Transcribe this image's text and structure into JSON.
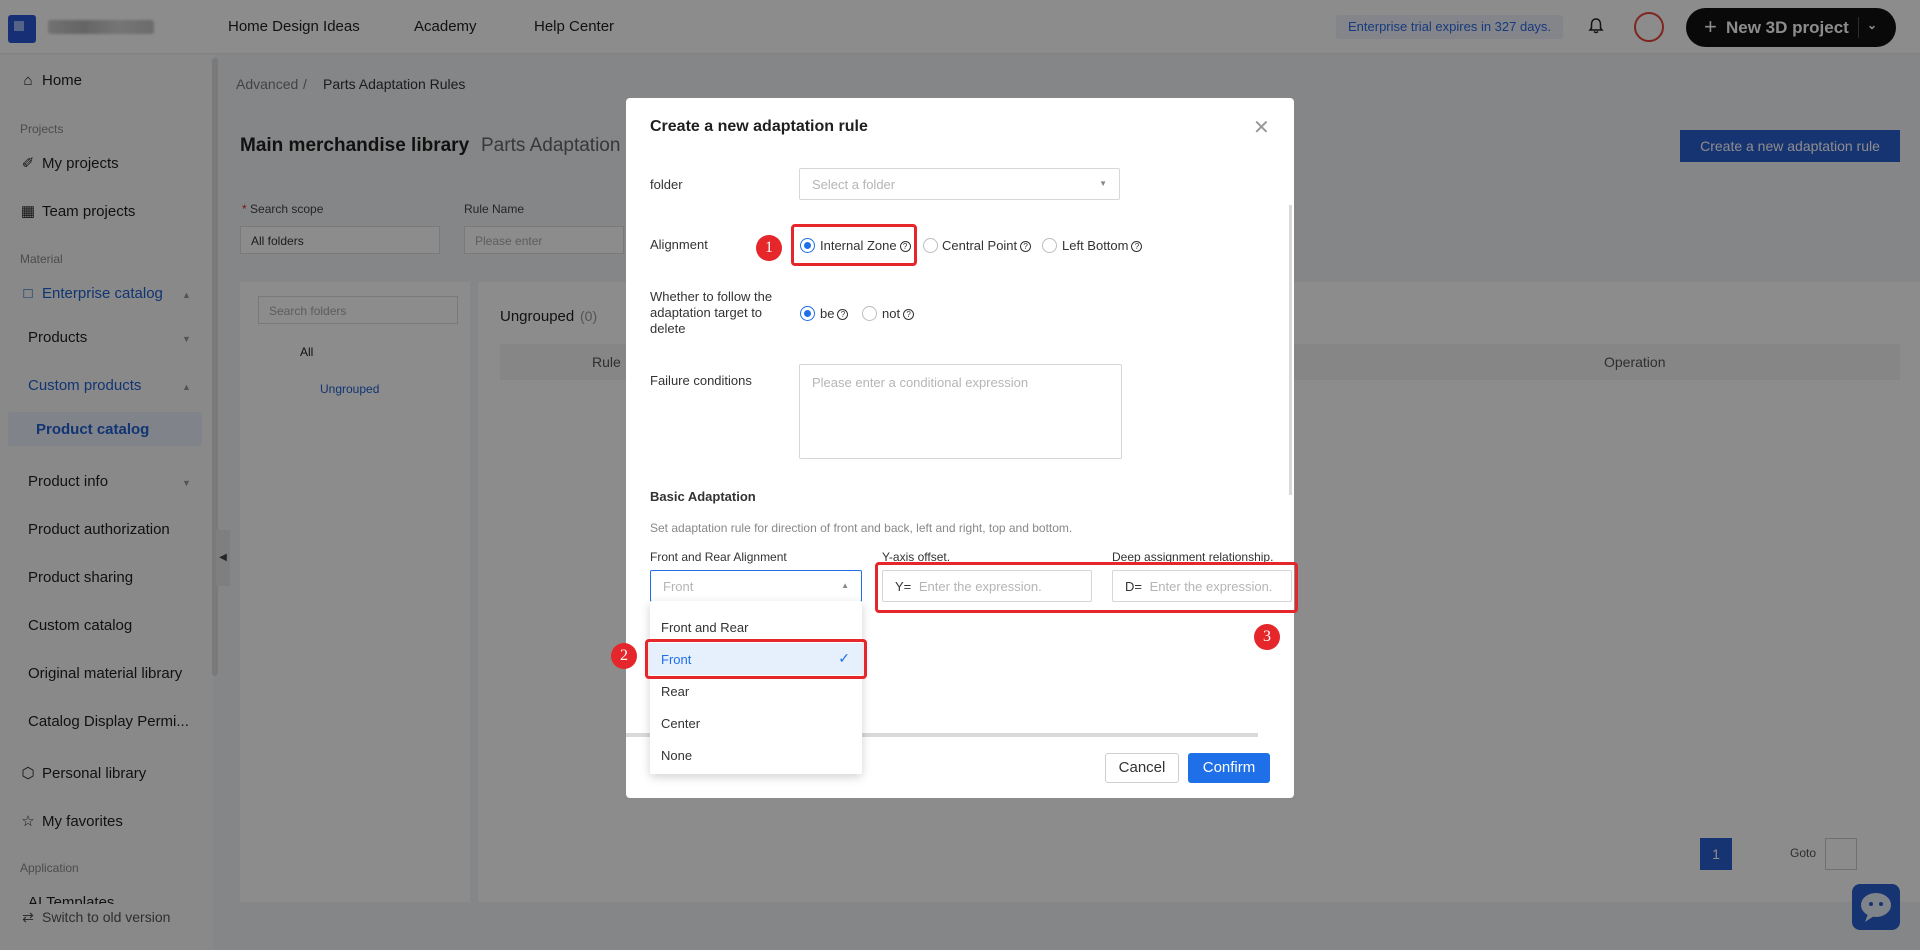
{
  "header": {
    "nav": [
      "Home Design Ideas",
      "Academy",
      "Help Center"
    ],
    "trial": "Enterprise trial expires in 327 days.",
    "new_project": "New 3D project"
  },
  "sidebar": {
    "home": "Home",
    "sec_projects": "Projects",
    "my_projects": "My projects",
    "team_projects": "Team projects",
    "sec_material": "Material",
    "enterprise_catalog": "Enterprise catalog",
    "products": "Products",
    "custom_products": "Custom products",
    "product_catalog": "Product catalog",
    "product_info": "Product info",
    "product_authorization": "Product authorization",
    "product_sharing": "Product sharing",
    "custom_catalog": "Custom catalog",
    "original_material": "Original material library",
    "catalog_display": "Catalog Display Permi...",
    "personal_library": "Personal library",
    "my_favorites": "My favorites",
    "sec_application": "Application",
    "ai_templates": "AI Templates",
    "switch_old": "Switch to old version"
  },
  "page": {
    "breadcrumb": [
      "Advanced",
      "Parts Adaptation Rules"
    ],
    "tab_main": "Main merchandise library",
    "tab_parts": "Parts Adaptation",
    "create_rule": "Create a new adaptation rule",
    "search_scope_label": "Search scope",
    "search_scope_value": "All folders",
    "rule_name_label": "Rule Name",
    "rule_name_placeholder": "Please enter",
    "search_folders_placeholder": "Search folders",
    "tree_all": "All",
    "tree_ungrouped": "Ungrouped",
    "list_title": "Ungrouped",
    "list_count": "(0)",
    "col_rule": "Rule",
    "col_operation": "Operation",
    "page_number": "1",
    "goto": "Goto"
  },
  "modal": {
    "title": "Create a new adaptation rule",
    "folder_label": "folder",
    "folder_placeholder": "Select a folder",
    "alignment_label": "Alignment",
    "alignment_options": [
      "Internal Zone",
      "Central Point",
      "Left Bottom"
    ],
    "follow_label": "Whether to follow the adaptation target to delete",
    "follow_options": [
      "be",
      "not"
    ],
    "failure_label": "Failure conditions",
    "failure_placeholder": "Please enter a conditional expression",
    "basic_title": "Basic Adaptation",
    "basic_desc": "Set adaptation rule for direction of front and back, left and right, top and bottom.",
    "front_rear_label": "Front and Rear Alignment",
    "front_rear_value": "Front",
    "y_label": "Y-axis offset.",
    "y_prefix": "Y=",
    "y_placeholder": "Enter the expression.",
    "d_label": "Deep assignment relationship.",
    "d_prefix": "D=",
    "d_placeholder": "Enter the expression.",
    "dropdown_options": [
      "Front and Rear",
      "Front",
      "Rear",
      "Center",
      "None"
    ],
    "cancel": "Cancel",
    "confirm": "Confirm"
  },
  "annotations": [
    "1",
    "2",
    "3"
  ],
  "colors": {
    "accent": "#1f6fe8",
    "highlight": "#e5262b",
    "brand": "#2b5fd0"
  }
}
